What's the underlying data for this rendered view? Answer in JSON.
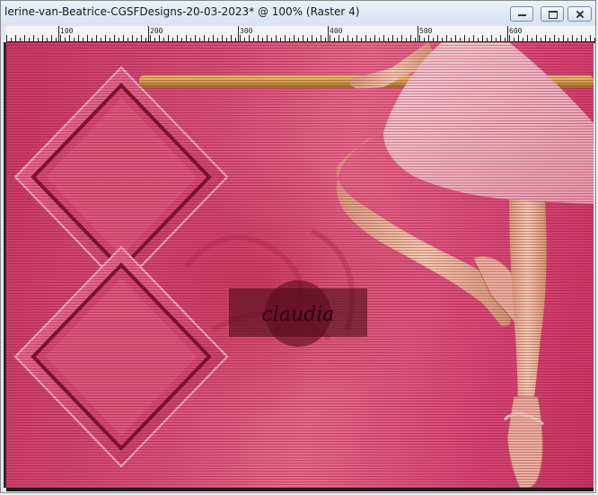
{
  "window": {
    "title": "lerine-van-Beatrice-CGSFDesigns-20-03-2023* @ 100% (Raster 4)"
  },
  "ruler": {
    "labels": [
      "100",
      "200",
      "300",
      "400",
      "500",
      "600"
    ]
  },
  "canvas": {
    "watermark_text": "claudia"
  },
  "colors": {
    "canvas_pink": "#d9527c",
    "frame_pink": "#e5608a",
    "bar_gold": "#d9a24a",
    "skirt_pink": "#f2b6c4",
    "skin": "#f1c4a8"
  }
}
